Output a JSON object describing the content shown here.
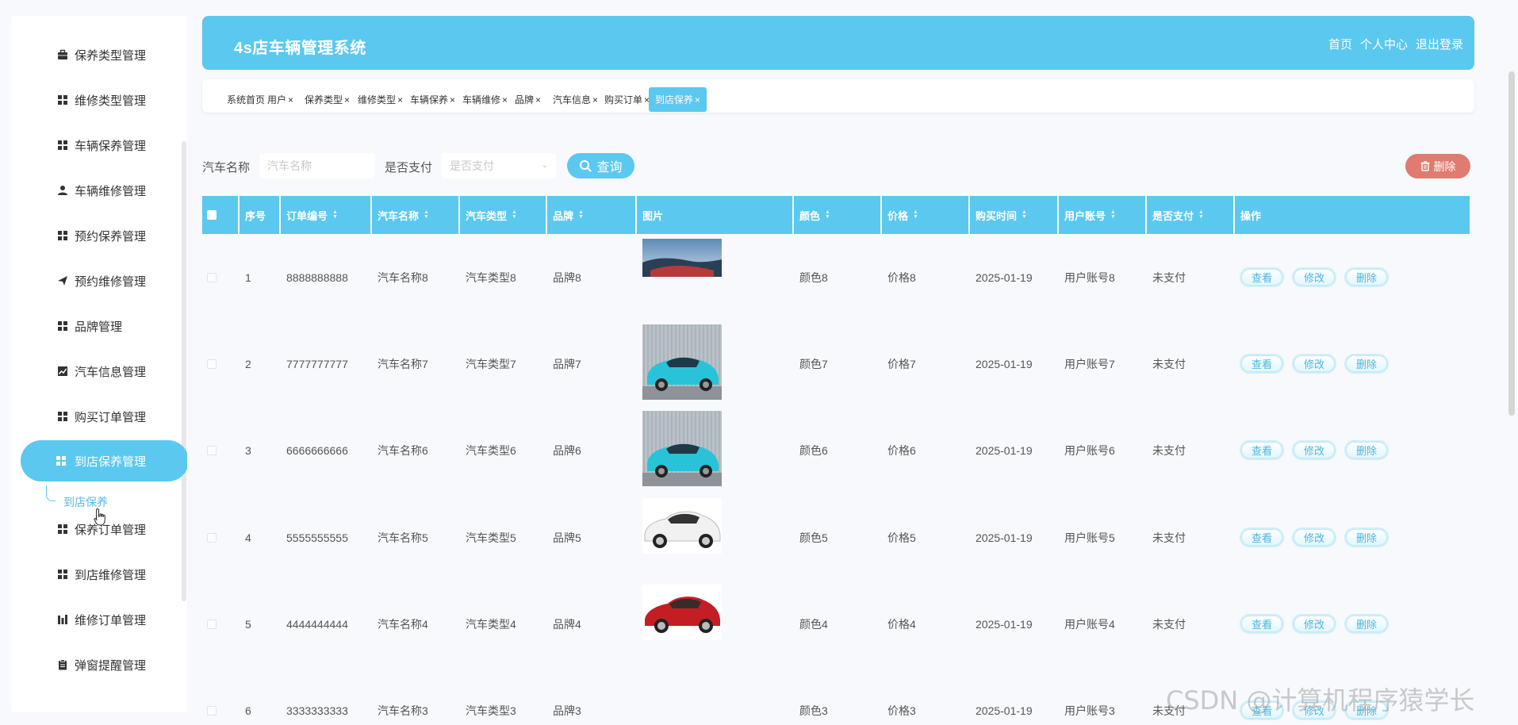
{
  "header": {
    "title": "4s店车辆管理系统",
    "nav": [
      "首页",
      "个人中心",
      "退出登录"
    ]
  },
  "sidebar": {
    "items": [
      {
        "label": "保养类型管理",
        "icon": "briefcase-icon"
      },
      {
        "label": "维修类型管理",
        "icon": "grid-icon"
      },
      {
        "label": "车辆保养管理",
        "icon": "grid-icon"
      },
      {
        "label": "车辆维修管理",
        "icon": "user-icon"
      },
      {
        "label": "预约保养管理",
        "icon": "grid-icon"
      },
      {
        "label": "预约维修管理",
        "icon": "send-icon"
      },
      {
        "label": "品牌管理",
        "icon": "grid-icon"
      },
      {
        "label": "汽车信息管理",
        "icon": "chart-icon"
      },
      {
        "label": "购买订单管理",
        "icon": "grid-icon"
      },
      {
        "label": "到店保养管理",
        "icon": "grid-icon",
        "active": true
      },
      {
        "label": "保养订单管理",
        "icon": "grid-icon"
      },
      {
        "label": "到店维修管理",
        "icon": "grid-icon"
      },
      {
        "label": "维修订单管理",
        "icon": "bar-icon"
      },
      {
        "label": "弹窗提醒管理",
        "icon": "clipboard-icon"
      }
    ],
    "submenu": "到店保养"
  },
  "tabs": [
    {
      "label": "系统首页",
      "closable": false
    },
    {
      "label": "用户",
      "closable": true
    },
    {
      "label": "保养类型",
      "closable": true
    },
    {
      "label": "维修类型",
      "closable": true
    },
    {
      "label": "车辆保养",
      "closable": true
    },
    {
      "label": "车辆维修",
      "closable": true
    },
    {
      "label": "品牌",
      "closable": true
    },
    {
      "label": "汽车信息",
      "closable": true
    },
    {
      "label": "购买订单",
      "closable": true
    },
    {
      "label": "到店保养",
      "closable": true,
      "active": true
    }
  ],
  "search": {
    "name_label": "汽车名称",
    "name_placeholder": "汽车名称",
    "paid_label": "是否支付",
    "paid_placeholder": "是否支付",
    "query_button": "查询",
    "delete_button": "删除"
  },
  "table": {
    "columns": [
      "序号",
      "订单编号",
      "汽车名称",
      "汽车类型",
      "品牌",
      "图片",
      "颜色",
      "价格",
      "购买时间",
      "用户账号",
      "是否支付",
      "操作"
    ],
    "actions": [
      "查看",
      "修改",
      "删除"
    ],
    "rows": [
      {
        "no": "1",
        "order": "8888888888",
        "name": "汽车名称8",
        "type": "汽车类型8",
        "brand": "品牌8",
        "image": "car-photo-sky",
        "color": "颜色8",
        "price": "价格8",
        "date": "2025-01-19",
        "user": "用户账号8",
        "paid": "未支付"
      },
      {
        "no": "2",
        "order": "7777777777",
        "name": "汽车名称7",
        "type": "汽车类型7",
        "brand": "品牌7",
        "image": "car-photo-cyan",
        "color": "颜色7",
        "price": "价格7",
        "date": "2025-01-19",
        "user": "用户账号7",
        "paid": "未支付"
      },
      {
        "no": "3",
        "order": "6666666666",
        "name": "汽车名称6",
        "type": "汽车类型6",
        "brand": "品牌6",
        "image": "car-photo-cyan",
        "color": "颜色6",
        "price": "价格6",
        "date": "2025-01-19",
        "user": "用户账号6",
        "paid": "未支付"
      },
      {
        "no": "4",
        "order": "5555555555",
        "name": "汽车名称5",
        "type": "汽车类型5",
        "brand": "品牌5",
        "image": "car-photo-white",
        "color": "颜色5",
        "price": "价格5",
        "date": "2025-01-19",
        "user": "用户账号5",
        "paid": "未支付"
      },
      {
        "no": "5",
        "order": "4444444444",
        "name": "汽车名称4",
        "type": "汽车类型4",
        "brand": "品牌4",
        "image": "car-photo-red",
        "color": "颜色4",
        "price": "价格4",
        "date": "2025-01-19",
        "user": "用户账号4",
        "paid": "未支付"
      },
      {
        "no": "6",
        "order": "3333333333",
        "name": "汽车名称3",
        "type": "汽车类型3",
        "brand": "品牌3",
        "image": "",
        "color": "颜色3",
        "price": "价格3",
        "date": "2025-01-19",
        "user": "用户账号3",
        "paid": "未支付"
      }
    ]
  },
  "watermark": "CSDN @计算机程序猿学长",
  "colors": {
    "accent": "#5bc8ef",
    "danger": "#e07b6f",
    "text": "#555555"
  }
}
